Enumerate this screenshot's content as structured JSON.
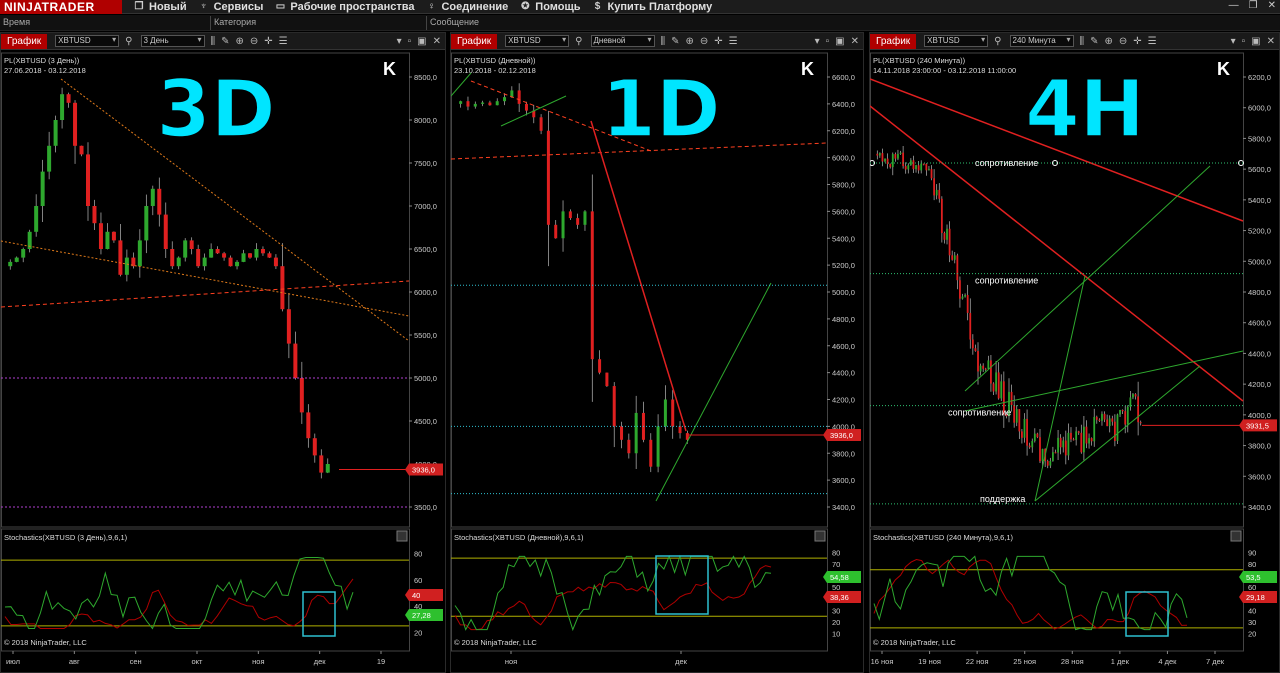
{
  "app": {
    "logo": "NINJATRADER"
  },
  "menu": [
    {
      "icon": "window-icon",
      "glyph": "❐",
      "label": "Новый"
    },
    {
      "icon": "services-icon",
      "glyph": "♆",
      "label": "Сервисы"
    },
    {
      "icon": "workspaces-icon",
      "glyph": "▭",
      "label": "Рабочие пространства"
    },
    {
      "icon": "connection-icon",
      "glyph": "♀",
      "label": "Соединение"
    },
    {
      "icon": "help-icon",
      "glyph": "✪",
      "label": "Помощь"
    },
    {
      "icon": "dollar-icon",
      "glyph": "$",
      "label": "Купить Платформу"
    }
  ],
  "columns": {
    "time": "Время",
    "category": "Категория",
    "message": "Сообщение"
  },
  "panels": [
    {
      "tab": "График",
      "instrument": "XBTUSD",
      "interval": "3 День",
      "title": "PL(XBTUSD (3 День))",
      "range": "27.06.2018 - 03.12.2018",
      "big_label": "3D",
      "price_ticks": [
        "8500,0",
        "8000,0",
        "7500,0",
        "7000,0",
        "6500,0",
        "6000,0",
        "5500,0",
        "5000,0",
        "4500,0",
        "4000,0",
        "3500,0"
      ],
      "last_price": "3936,0",
      "stoch_title": "Stochastics(XBTUSD (3 День),9,6,1)",
      "stoch_ticks": [
        "80",
        "60",
        "40",
        "20"
      ],
      "stoch_badges": [
        "40",
        "27,28"
      ],
      "copyright": "© 2018 NinjaTrader, LLC",
      "x_ticks": [
        "июл",
        "авг",
        "сен",
        "окт",
        "ноя",
        "дек",
        "19"
      ]
    },
    {
      "tab": "График",
      "instrument": "XBTUSD",
      "interval": "Дневной",
      "title": "PL(XBTUSD (Дневной))",
      "range": "23.10.2018 - 02.12.2018",
      "big_label": "1D",
      "price_ticks": [
        "6600,0",
        "6400,0",
        "6200,0",
        "6000,0",
        "5800,0",
        "5600,0",
        "5400,0",
        "5200,0",
        "5000,0",
        "4800,0",
        "4600,0",
        "4400,0",
        "4200,0",
        "4000,0",
        "3800,0",
        "3600,0",
        "3400,0"
      ],
      "last_price": "3936,0",
      "stoch_title": "Stochastics(XBTUSD (Дневной),9,6,1)",
      "stoch_ticks": [
        "80",
        "70",
        "60",
        "50",
        "40",
        "30",
        "20",
        "10"
      ],
      "stoch_badges": [
        "54,58",
        "38,36"
      ],
      "copyright": "© 2018 NinjaTrader, LLC",
      "x_ticks": [
        "ноя",
        "дек"
      ]
    },
    {
      "tab": "График",
      "instrument": "XBTUSD",
      "interval": "240 Минута",
      "title": "PL(XBTUSD (240 Минута))",
      "range": "14.11.2018 23:00:00 - 03.12.2018 11:00:00",
      "big_label": "4H",
      "price_ticks": [
        "6200,0",
        "6000,0",
        "5800,0",
        "5600,0",
        "5400,0",
        "5200,0",
        "5000,0",
        "4800,0",
        "4600,0",
        "4400,0",
        "4200,0",
        "4000,0",
        "3800,0",
        "3600,0",
        "3400,0"
      ],
      "last_price": "3931,5",
      "annotations": [
        "сопротивление",
        "сопротивление",
        "сопротивление",
        "поддержка"
      ],
      "stoch_title": "Stochastics(XBTUSD (240 Минута),9,6,1)",
      "stoch_ticks": [
        "90",
        "80",
        "70",
        "60",
        "50",
        "40",
        "30",
        "20"
      ],
      "stoch_badges": [
        "53,5",
        "29,18"
      ],
      "copyright": "© 2018 NinjaTrader, LLC",
      "x_ticks": [
        "16 ноя",
        "19 ноя",
        "22 ноя",
        "25 ноя",
        "28 ноя",
        "1 дек",
        "4 дек",
        "7 дек"
      ]
    }
  ],
  "colors": {
    "up": "#2ea82e",
    "down": "#e02020",
    "big_label": "#00e5ff",
    "stoch_k": "#2ea82e",
    "stoch_d": "#b00000",
    "level": "#b0b000",
    "box": "#2ec0d0",
    "purple": "#b040d0",
    "orange": "#e07a1a"
  }
}
